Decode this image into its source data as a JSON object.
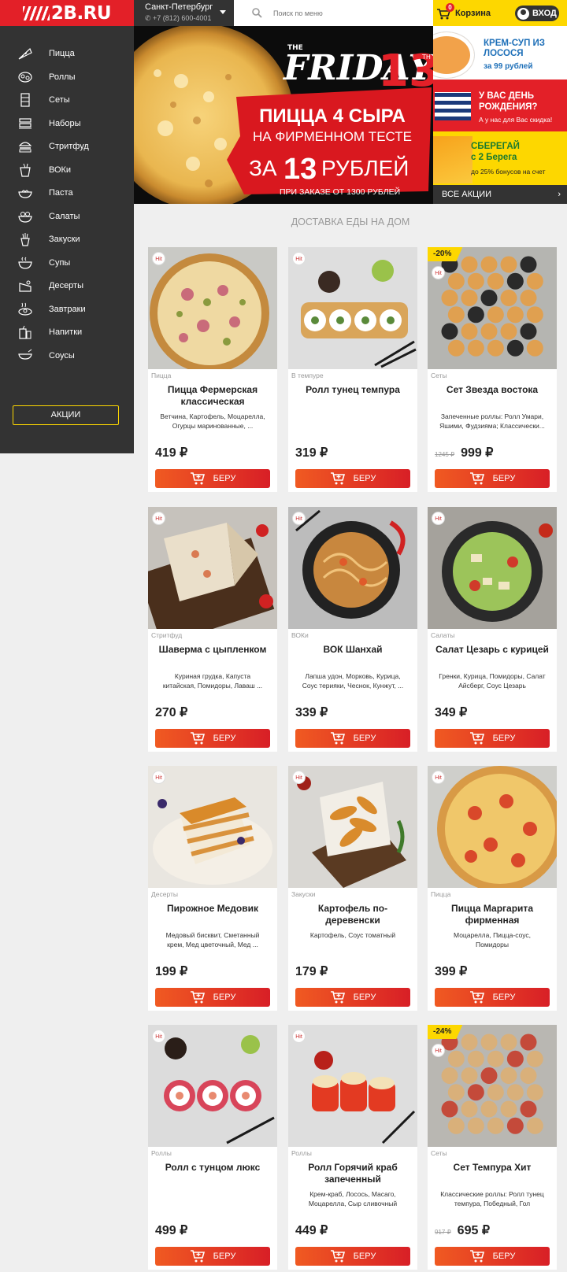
{
  "header": {
    "logo": "2B.RU",
    "city": "Санкт-Петербург",
    "phone": "+7 (812) 600-4001",
    "search_placeholder": "Поиск по меню",
    "cart_label": "Корзина",
    "cart_count": "0",
    "login_label": "ВХОД"
  },
  "sidebar": {
    "items": [
      {
        "label": "Пицца",
        "icon": "pizza-icon"
      },
      {
        "label": "Роллы",
        "icon": "rolls-icon"
      },
      {
        "label": "Сеты",
        "icon": "sets-icon"
      },
      {
        "label": "Наборы",
        "icon": "combos-icon"
      },
      {
        "label": "Стритфуд",
        "icon": "burger-icon"
      },
      {
        "label": "ВОКи",
        "icon": "wok-box-icon"
      },
      {
        "label": "Паста",
        "icon": "pasta-icon"
      },
      {
        "label": "Салаты",
        "icon": "salad-icon"
      },
      {
        "label": "Закуски",
        "icon": "fries-icon"
      },
      {
        "label": "Супы",
        "icon": "soup-icon"
      },
      {
        "label": "Десерты",
        "icon": "dessert-icon"
      },
      {
        "label": "Завтраки",
        "icon": "breakfast-icon"
      },
      {
        "label": "Напитки",
        "icon": "drinks-icon"
      },
      {
        "label": "Соусы",
        "icon": "sauce-icon"
      }
    ],
    "promo_button": "АКЦИИ"
  },
  "banner": {
    "the": "THE",
    "friday": "FRIDAY",
    "num": "13",
    "th": "TH",
    "line1": "ПИЦЦА 4 СЫРА",
    "line2": "НА ФИРМЕННОМ ТЕСТЕ",
    "price_prefix": "ЗА",
    "price_num": "13",
    "price_suffix": "РУБЛЕЙ",
    "note": "ПРИ ЗАКАЗЕ ОТ 1300 РУБЛЕЙ"
  },
  "side_promos": {
    "p1_title": "КРЕМ-СУП ИЗ ЛОСОСЯ",
    "p1_sub": "за 99 рублей",
    "p2_title": "У ВАС ДЕНЬ РОЖДЕНИЯ?",
    "p2_sub": "А у нас для Вас скидка!",
    "p3_title": "СБЕРЕГАЙ с 2 Берега",
    "p3_sub": "до 25% бонусов на счет",
    "all_actions": "ВСЕ АКЦИИ"
  },
  "section_title": "ДОСТАВКА ЕДЫ НА ДОМ",
  "buy_label": "БЕРУ",
  "products": [
    {
      "category": "Пицца",
      "title": "Пицца Фермерская классическая",
      "desc": "Ветчина, Картофель, Моцарелла, Огурцы маринованные, ...",
      "price": "419 ₽",
      "old": "",
      "discount": "",
      "hit": "Hit",
      "photo": "pizza-farm"
    },
    {
      "category": "В темпуре",
      "title": "Ролл тунец темпура",
      "desc": "",
      "price": "319 ₽",
      "old": "",
      "discount": "",
      "hit": "Hit",
      "photo": "roll-tempura"
    },
    {
      "category": "Сеты",
      "title": "Сет Звезда востока",
      "desc": "Запеченные роллы: Ролл Умари, Яшими, Фудзияма; Классически...",
      "price": "999 ₽",
      "old": "1245 ₽",
      "discount": "-20%",
      "hit": "Hit",
      "photo": "set-star"
    },
    {
      "category": "Стритфуд",
      "title": "Шаверма с цыпленком",
      "desc": "Куриная грудка, Капуста китайская, Помидоры, Лаваш ...",
      "price": "270 ₽",
      "old": "",
      "discount": "",
      "hit": "Hit",
      "photo": "shawarma"
    },
    {
      "category": "ВОКи",
      "title": "ВОК Шанхай",
      "desc": "Лапша удон, Морковь, Курица, Соус терияки, Чеснок, Кунжут, ...",
      "price": "339 ₽",
      "old": "",
      "discount": "",
      "hit": "Hit",
      "photo": "wok"
    },
    {
      "category": "Салаты",
      "title": "Салат Цезарь с курицей",
      "desc": "Гренки, Курица, Помидоры, Салат Айсберг, Соус Цезарь",
      "price": "349 ₽",
      "old": "",
      "discount": "",
      "hit": "Hit",
      "photo": "caesar"
    },
    {
      "category": "Десерты",
      "title": "Пирожное Медовик",
      "desc": "Медовый бисквит, Сметанный крем, Мед цветочный, Мед ...",
      "price": "199 ₽",
      "old": "",
      "discount": "",
      "hit": "Hit",
      "photo": "medovik"
    },
    {
      "category": "Закуски",
      "title": "Картофель по-деревенски",
      "desc": "Картофель, Соус томатный",
      "price": "179 ₽",
      "old": "",
      "discount": "",
      "hit": "Hit",
      "photo": "potato"
    },
    {
      "category": "Пицца",
      "title": "Пицца Маргарита фирменная",
      "desc": "Моцарелла, Пицца-соус, Помидоры",
      "price": "399 ₽",
      "old": "",
      "discount": "",
      "hit": "Hit",
      "photo": "margarita"
    },
    {
      "category": "Роллы",
      "title": "Ролл с тунцом люкс",
      "desc": "",
      "price": "499 ₽",
      "old": "",
      "discount": "",
      "hit": "Hit",
      "photo": "tuna-roll"
    },
    {
      "category": "Роллы",
      "title": "Ролл Горячий краб запеченный",
      "desc": "Крем-краб, Лосось, Масаго, Моцарелла, Сыр сливочный",
      "price": "449 ₽",
      "old": "",
      "discount": "",
      "hit": "Hit",
      "photo": "crab-roll"
    },
    {
      "category": "Сеты",
      "title": "Сет Темпура Хит",
      "desc": "Классические роллы: Ролл тунец темпура, Победный, Гол",
      "price": "695 ₽",
      "old": "917 ₽",
      "discount": "-24%",
      "hit": "Hit",
      "photo": "tempura-set"
    }
  ]
}
